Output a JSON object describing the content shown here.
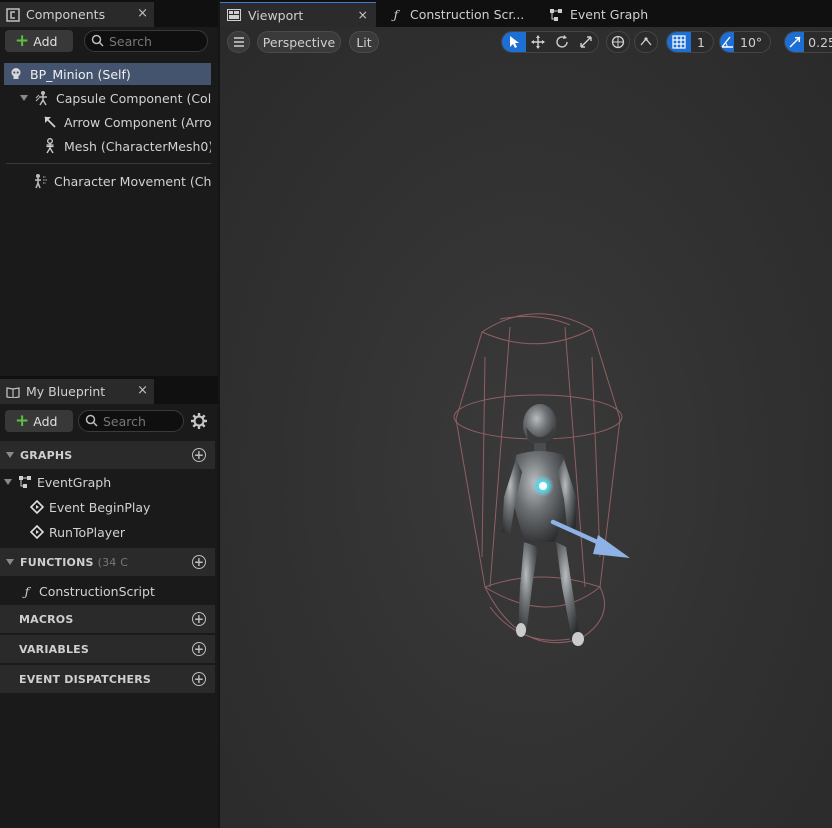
{
  "components_panel": {
    "tab_label": "Components",
    "close": "×",
    "add_label": "Add",
    "search_placeholder": "Search",
    "items": [
      {
        "label": "BP_Minion (Self)",
        "icon": "skull-icon"
      },
      {
        "label": "Capsule Component (Collisi",
        "icon": "capsule-icon"
      },
      {
        "label": "Arrow Component (Arrow",
        "icon": "arrow-icon"
      },
      {
        "label": "Mesh (CharacterMesh0)",
        "icon": "skeleton-icon"
      },
      {
        "label": "Character Movement (Char",
        "icon": "movement-icon"
      }
    ]
  },
  "blueprint_panel": {
    "tab_label": "My Blueprint",
    "close": "×",
    "add_label": "Add",
    "search_placeholder": "Search",
    "graphs_label": "GRAPHS",
    "event_graph": "EventGraph",
    "events": [
      "Event BeginPlay",
      "RunToPlayer"
    ],
    "functions_label": "FUNCTIONS",
    "functions_count": "(34 C",
    "construction_script": "ConstructionScript",
    "macros_label": "MACROS",
    "variables_label": "VARIABLES",
    "dispatchers_label": "EVENT DISPATCHERS"
  },
  "editor_tabs": [
    {
      "label": "Viewport",
      "close": "×"
    },
    {
      "label": "Construction Scr..."
    },
    {
      "label": "Event Graph"
    }
  ],
  "viewport": {
    "perspective_label": "Perspective",
    "lit_label": "Lit",
    "grid_value": "1",
    "angle_value": "10°",
    "scale_value": "0.25"
  },
  "colors": {
    "accent": "#1d6fd3",
    "selection": "#45546e",
    "add_green": "#5fbf3f",
    "collision_wire": "#9a6468",
    "arrow": "#8fb2e6"
  }
}
